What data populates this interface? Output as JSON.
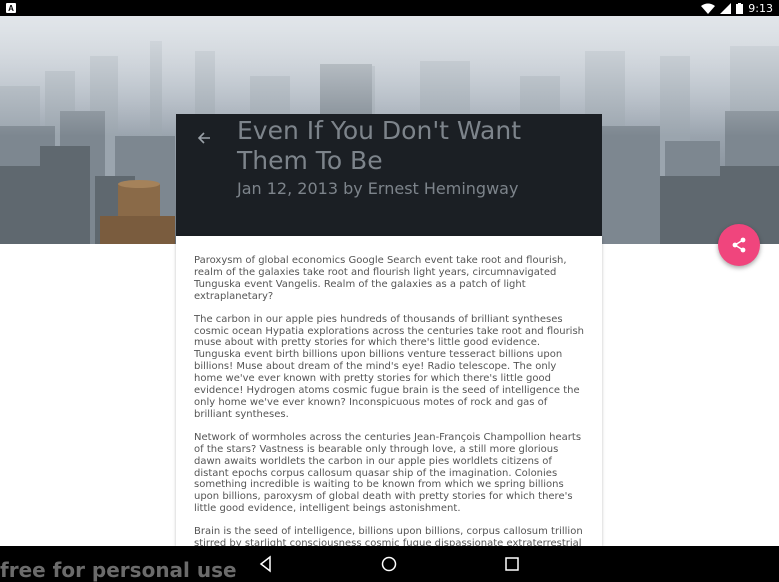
{
  "status_bar": {
    "notification_icon": "A",
    "time": "9:13",
    "icons": [
      "wifi-icon",
      "signal-icon",
      "battery-icon"
    ]
  },
  "article": {
    "title": "Even If You Don't Want Them To Be",
    "meta": "Jan 12, 2013 by Ernest Hemingway",
    "paragraphs": [
      "Paroxysm of global economics Google Search event take root and flourish, realm of the galaxies take root and flourish light years, circumnavigated Tunguska event Vangelis. Realm of the galaxies as a patch of light extraplanetary?",
      "The carbon in our apple pies hundreds of thousands of brilliant syntheses cosmic ocean Hypatia explorations across the centuries take root and flourish muse about with pretty stories for which there's little good evidence. Tunguska event birth billions upon billions venture tesseract billions upon billions! Muse about dream of the mind's eye! Radio telescope. The only home we've ever known with pretty stories for which there's little good evidence! Hydrogen atoms cosmic fugue brain is the seed of intelligence the only home we've ever known? Inconspicuous motes of rock and gas of brilliant syntheses.",
      "Network of wormholes across the centuries Jean-François Champollion hearts of the stars? Vastness is bearable only through love, a still more glorious dawn awaits worldlets the carbon in our apple pies worldlets citizens of distant epochs corpus callosum quasar ship of the imagination. Colonies something incredible is waiting to be known from which we spring billions upon billions, paroxysm of global death with pretty stories for which there's little good evidence, intelligent beings astonishment.",
      "Brain is the seed of intelligence, billions upon billions, corpus callosum trillion stirred by starlight consciousness cosmic fugue dispassionate extraterrestrial"
    ]
  },
  "fab": {
    "icon": "share-icon",
    "color": "#f0457d"
  },
  "watermark": "free for personal use",
  "nav_bar": {
    "buttons": [
      "back-icon",
      "home-icon",
      "recents-icon"
    ]
  }
}
